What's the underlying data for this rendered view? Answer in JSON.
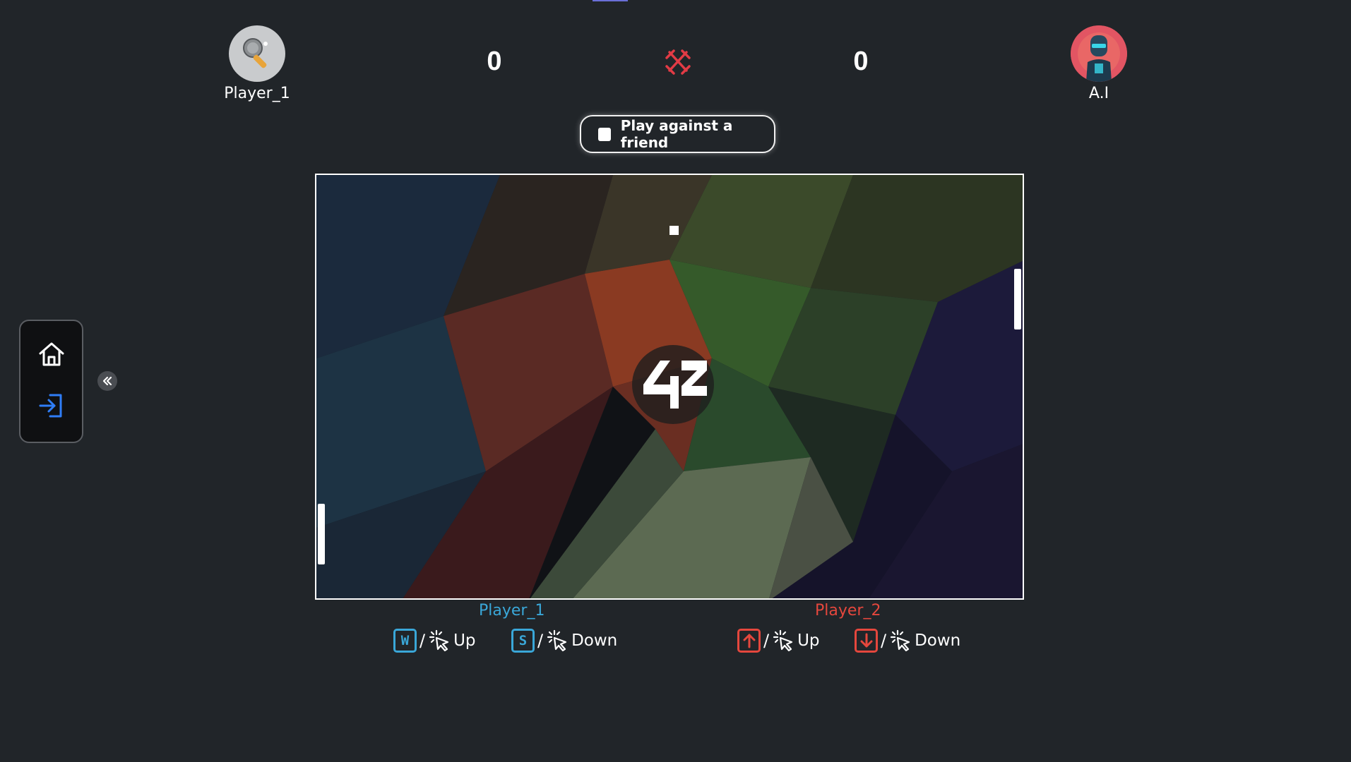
{
  "header": {
    "player_left": {
      "name": "Player_1",
      "score": "0",
      "avatar_icon": "ping-pong-paddle-icon"
    },
    "player_right": {
      "name": "A.I",
      "score": "0",
      "avatar_icon": "robot-avatar-icon"
    },
    "vs_icon": "crossed-swords-icon"
  },
  "mode_toggle": {
    "label": "Play against a friend",
    "checked": false
  },
  "game": {
    "logo_text": "42"
  },
  "controls": {
    "player1": {
      "title": "Player_1",
      "up_key": "W",
      "up_label": "Up",
      "down_key": "S",
      "down_label": "Down",
      "color": "#3aa7d8"
    },
    "player2": {
      "title": "Player_2",
      "up_key": "arrow-up",
      "up_label": "Up",
      "down_key": "arrow-down",
      "down_label": "Down",
      "color": "#e5473d"
    },
    "separator": "/"
  },
  "sidebar": {
    "items": [
      {
        "icon": "home-icon"
      },
      {
        "icon": "login-icon"
      }
    ],
    "collapse_icon": "double-chevron-left-icon"
  },
  "colors": {
    "background": "#212529",
    "accent_blue": "#3aa7d8",
    "accent_red": "#e5473d",
    "login_blue": "#2f7df6"
  }
}
